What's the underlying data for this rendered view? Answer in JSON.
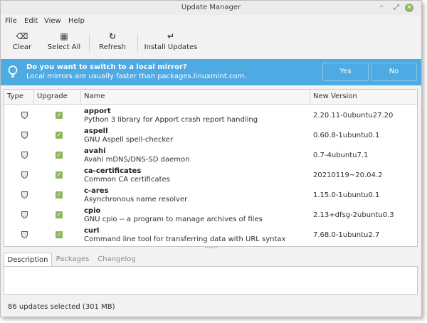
{
  "window": {
    "title": "Update Manager",
    "controls": {
      "minimize": "–",
      "maximize": "⤢",
      "close": "✕"
    }
  },
  "menu": [
    "File",
    "Edit",
    "View",
    "Help"
  ],
  "toolbar": {
    "buttons": [
      {
        "label": "Clear",
        "icon": "backspace-icon",
        "glyph": "⌫"
      },
      {
        "label": "Select All",
        "icon": "select-all-icon",
        "glyph": "▦"
      },
      {
        "label": "Refresh",
        "icon": "refresh-icon",
        "glyph": "↻"
      },
      {
        "label": "Install Updates",
        "icon": "return-arrow-icon",
        "glyph": "↵"
      }
    ]
  },
  "banner": {
    "question": "Do you want to switch to a local mirror?",
    "detail": "Local mirrors are usually faster than packages.linuxmint.com.",
    "yes_label": "Yes",
    "no_label": "No",
    "color": "#4eaae3"
  },
  "table": {
    "columns": [
      "Type",
      "Upgrade",
      "Name",
      "New Version"
    ],
    "rows": [
      {
        "name": "apport",
        "description": "Python 3 library for Apport crash report handling",
        "version": "2.20.11-0ubuntu27.20",
        "checked": true,
        "check_glyph": "✓"
      },
      {
        "name": "aspell",
        "description": "GNU Aspell spell-checker",
        "version": "0.60.8-1ubuntu0.1",
        "checked": true,
        "check_glyph": "✓"
      },
      {
        "name": "avahi",
        "description": "Avahi mDNS/DNS-SD daemon",
        "version": "0.7-4ubuntu7.1",
        "checked": true,
        "check_glyph": "✓"
      },
      {
        "name": "ca-certificates",
        "description": "Common CA certificates",
        "version": "20210119~20.04.2",
        "checked": true,
        "check_glyph": "✓"
      },
      {
        "name": "c-ares",
        "description": "Asynchronous name resolver",
        "version": "1.15.0-1ubuntu0.1",
        "checked": true,
        "check_glyph": "✓"
      },
      {
        "name": "cpio",
        "description": "GNU cpio -- a program to manage archives of files",
        "version": "2.13+dfsg-2ubuntu0.3",
        "checked": true,
        "check_glyph": "✓"
      },
      {
        "name": "curl",
        "description": "Command line tool for transferring data with URL syntax",
        "version": "7.68.0-1ubuntu2.7",
        "checked": true,
        "check_glyph": "✓"
      }
    ]
  },
  "tabs": [
    "Description",
    "Packages",
    "Changelog"
  ],
  "status": "86 updates selected (301 MB)",
  "accent": "#8fb65c"
}
